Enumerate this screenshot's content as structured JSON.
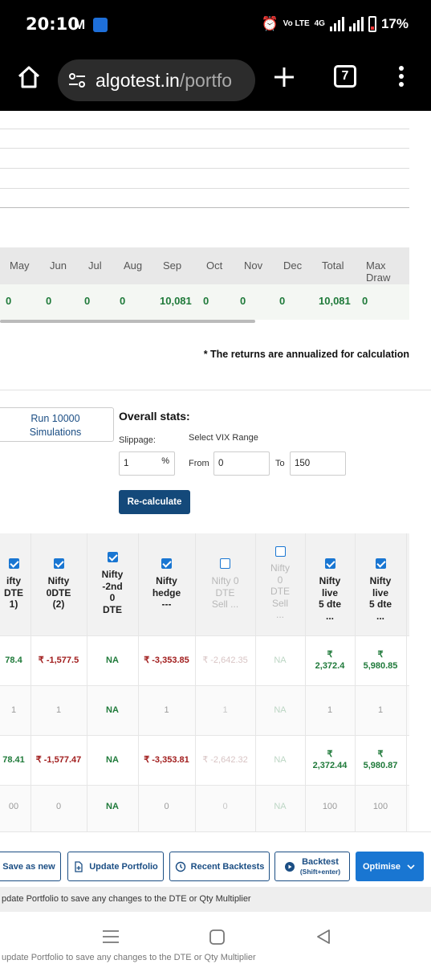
{
  "status_bar": {
    "time": "20:10",
    "mail_glyph": "M",
    "network_label": "Vo LTE",
    "net_type": "4G",
    "battery": "17%"
  },
  "browser": {
    "url_host": "algotest.in",
    "url_path": "/portfo",
    "tab_count": "7"
  },
  "monthly": {
    "headers": [
      "May",
      "Jun",
      "Jul",
      "Aug",
      "Sep",
      "Oct",
      "Nov",
      "Dec",
      "Total",
      "Max Draw"
    ],
    "values": [
      "0",
      "0",
      "0",
      "0",
      "10,081",
      "0",
      "0",
      "0",
      "10,081",
      "0"
    ]
  },
  "note": "* The returns are annualized for calculation",
  "simulation": {
    "run_label_line1": "Run 10000",
    "run_label_line2": "Simulations",
    "overall_stats": "Overall stats:",
    "slippage_label": "Slippage:",
    "slippage_value": "1",
    "slippage_unit": "%",
    "vix_label": "Select VIX Range",
    "from_label": "From",
    "from_value": "0",
    "to_label": "To",
    "to_value": "150",
    "recalc_label": "Re-calculate"
  },
  "strategies": {
    "columns": [
      {
        "name": [
          "ifty",
          "DTE",
          "1)"
        ],
        "checked": true,
        "enabled": true
      },
      {
        "name": [
          "Nifty",
          "0DTE",
          "(2)"
        ],
        "checked": true,
        "enabled": true
      },
      {
        "name": [
          "Nifty",
          "-2nd",
          "0",
          "DTE"
        ],
        "checked": true,
        "enabled": true
      },
      {
        "name": [
          "Nifty",
          "hedge",
          "---"
        ],
        "checked": true,
        "enabled": true
      },
      {
        "name": [
          "Nifty 0",
          "DTE",
          "Sell ..."
        ],
        "checked": false,
        "enabled": false
      },
      {
        "name": [
          "Nifty",
          "0",
          "DTE",
          "Sell",
          "..."
        ],
        "checked": false,
        "enabled": false
      },
      {
        "name": [
          "Nifty",
          "live",
          "5 dte",
          "..."
        ],
        "checked": true,
        "enabled": true
      },
      {
        "name": [
          "Nifty",
          "live",
          "5 dte",
          "..."
        ],
        "checked": true,
        "enabled": true
      }
    ],
    "row1": [
      "78.4",
      "₹ -1,577.5",
      "NA",
      "₹ -3,353.85",
      "₹ -2,642.35",
      "NA",
      "₹ 2,372.4",
      "₹ 5,980.85"
    ],
    "row2": [
      "1",
      "1",
      "NA",
      "1",
      "1",
      "NA",
      "1",
      "1"
    ],
    "row3": [
      "78.41",
      "₹ -1,577.47",
      "NA",
      "₹ -3,353.81",
      "₹ -2,642.32",
      "NA",
      "₹ 2,372.44",
      "₹ 5,980.87"
    ],
    "row4": [
      "00",
      "0",
      "NA",
      "0",
      "0",
      "NA",
      "100",
      "100"
    ]
  },
  "toolbar": {
    "save_as_new": "Save as new",
    "update_portfolio": "Update Portfolio",
    "recent_backtests": "Recent Backtests",
    "backtest": "Backtest",
    "backtest_shortcut": "(Shift+enter)",
    "optimise": "Optimise"
  },
  "hint": "pdate Portfolio to save any changes to the DTE or Qty Multiplier",
  "ghost_hint": "update Portfolio to save any changes to the DTE or Qty Multiplier"
}
